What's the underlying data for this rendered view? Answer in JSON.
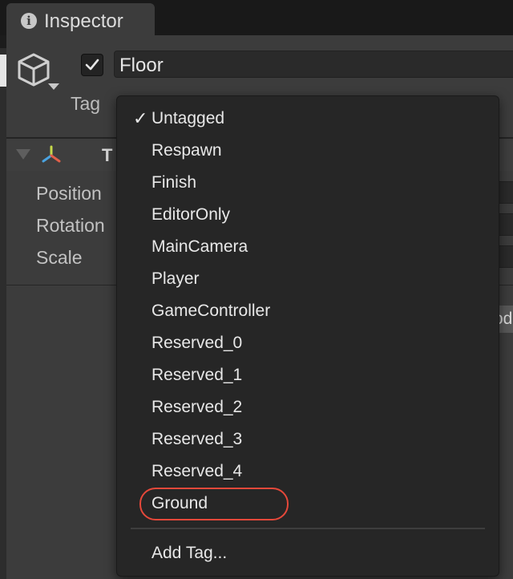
{
  "tab": {
    "title": "Inspector",
    "icon": "info-icon"
  },
  "gameobject": {
    "icon": "cube-icon",
    "active": true,
    "name": "Floor",
    "tag_label": "Tag"
  },
  "transform": {
    "title": "T",
    "icon": "transform-axes-icon",
    "properties": [
      "Position",
      "Rotation",
      "Scale"
    ]
  },
  "partial_button": {
    "text": "od"
  },
  "tag_menu": {
    "selected": "Untagged",
    "items": [
      "Untagged",
      "Respawn",
      "Finish",
      "EditorOnly",
      "MainCamera",
      "Player",
      "GameController",
      "Reserved_0",
      "Reserved_1",
      "Reserved_2",
      "Reserved_3",
      "Reserved_4",
      "Ground"
    ],
    "add_tag": "Add Tag...",
    "highlighted": "Ground",
    "highlight_color": "#e5483a"
  },
  "colors": {
    "background": "#1c1c1c",
    "panel": "#3c3c3c",
    "menu": "#262626",
    "text": "#e8e8e8"
  }
}
